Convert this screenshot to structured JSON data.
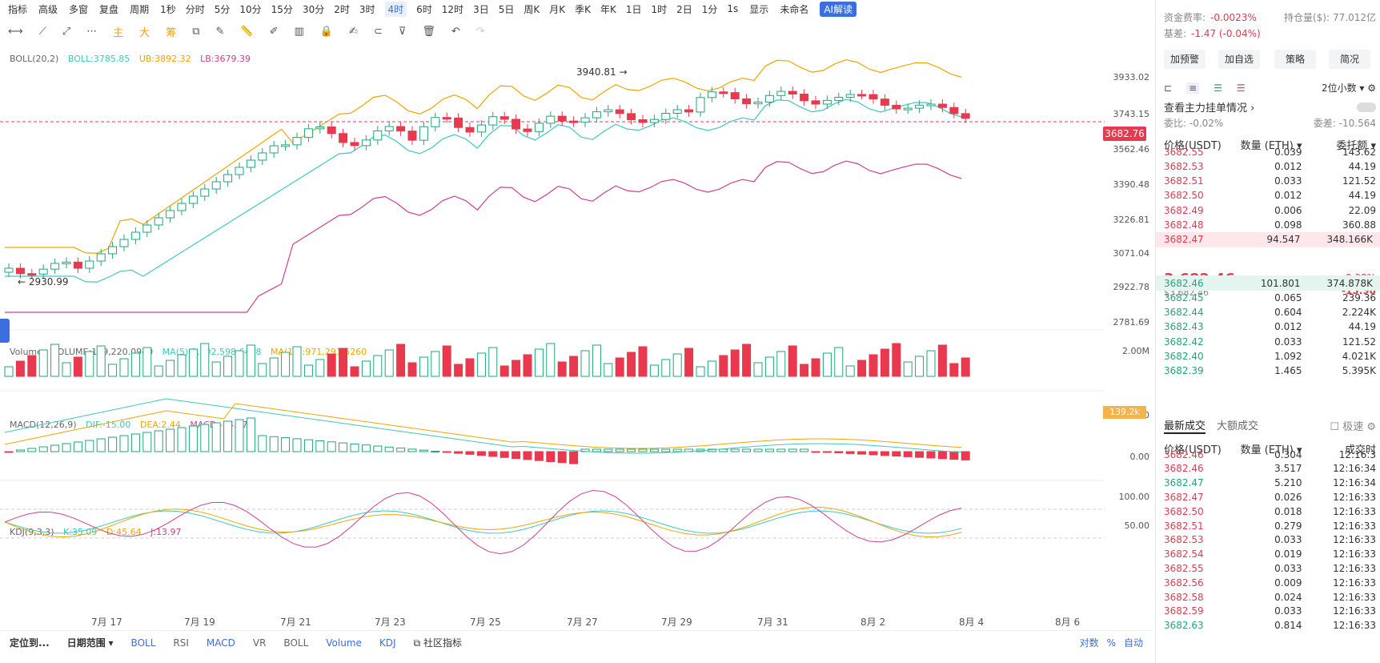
{
  "topbar": {
    "items": [
      "指标",
      "高级",
      "多窗",
      "复盘",
      "周期"
    ],
    "timeframes": [
      "1秒",
      "分时",
      "5分",
      "10分",
      "15分",
      "30分",
      "2时",
      "3时",
      "4时",
      "6时",
      "12时",
      "3日",
      "5日",
      "周K",
      "月K",
      "季K",
      "年K",
      "1日",
      "1时",
      "2日",
      "1分"
    ],
    "active_timeframe": "4时",
    "right_items": [
      "1s",
      "显示",
      "未命名",
      "AI解读"
    ]
  },
  "toolbar": {
    "items": [
      "主",
      "大",
      "筹"
    ]
  },
  "indicators": {
    "boll": {
      "name": "BOLL(20,2)",
      "boll": "BOLL:3785.85",
      "ub": "UB:3892.32",
      "lb": "LB:3679.39"
    },
    "volume": {
      "name": "Volume",
      "volume": "VOLUME:139,220.0940",
      "ma5": "MA(5):1,102,598.6438",
      "ma10": "MA(10):971,291.5260"
    },
    "macd": {
      "name": "MACD(12,26,9)",
      "dif": "DIF:-15.00",
      "dea": "DEA:2.44",
      "macd": "MACD:-34.87"
    },
    "kdj": {
      "name": "KDJ(9,3,3)",
      "k": "K:35.09",
      "d": "D:45.64",
      "j": "J:13.97"
    }
  },
  "price_axis": [
    "3933.02",
    "3743.15",
    "3562.46",
    "3390.48",
    "3226.81",
    "3071.04",
    "2922.78",
    "2781.69"
  ],
  "volume_axis": [
    "2.00M"
  ],
  "macd_axis": [
    "100.00",
    "0.00"
  ],
  "kdj_axis": [
    "100.00",
    "50.00"
  ],
  "current_price_tag": "3682.76",
  "volume_tag": "139.2k",
  "annotations": {
    "high": "3940.81",
    "low": "2930.99"
  },
  "x_axis": [
    "7月 17",
    "7月 19",
    "7月 21",
    "7月 23",
    "7月 25",
    "7月 27",
    "7月 29",
    "7月 31",
    "8月 2",
    "8月 4",
    "8月 6"
  ],
  "bottombar": {
    "locate": "定位到...",
    "date_range": "日期范围",
    "tabs": [
      "BOLL",
      "RSI",
      "MACD",
      "VR",
      "BOLL",
      "Volume",
      "KDJ"
    ],
    "community": "社区指标",
    "right": [
      "对数",
      "%",
      "自动"
    ]
  },
  "right_panel": {
    "header": [
      {
        "label": "资金费率:",
        "value": "-0.0023%"
      },
      {
        "label": "持仓量($):",
        "value": "77.012亿"
      },
      {
        "label": "基差:",
        "value": "-1.47 (-0.04%)"
      }
    ],
    "buttons": [
      "加预警",
      "加自选",
      "策略",
      "简况"
    ],
    "decimals": "2位小数",
    "main_orders": "查看主力挂单情况",
    "wei_bi": "委比: -0.02%",
    "wei_cha": "委差: -10.564",
    "book_headers": [
      "价格(USDT)",
      "数量 (ETH)",
      "委托额"
    ],
    "asks": [
      [
        "3682.55",
        "0.039",
        "143.62"
      ],
      [
        "3682.53",
        "0.012",
        "44.19"
      ],
      [
        "3682.51",
        "0.033",
        "121.52"
      ],
      [
        "3682.50",
        "0.012",
        "44.19"
      ],
      [
        "3682.49",
        "0.006",
        "22.09"
      ],
      [
        "3682.48",
        "0.098",
        "360.88"
      ],
      [
        "3682.47",
        "94.547",
        "348.166K"
      ]
    ],
    "last_price": "3,682.46",
    "last_price_sub": "$3,682.46",
    "change_pct": "-0.38%",
    "change_abs": "-13.98",
    "bids": [
      [
        "3682.46",
        "101.801",
        "374.878K"
      ],
      [
        "3682.45",
        "0.065",
        "239.36"
      ],
      [
        "3682.44",
        "0.604",
        "2.224K"
      ],
      [
        "3682.43",
        "0.012",
        "44.19"
      ],
      [
        "3682.42",
        "0.033",
        "121.52"
      ],
      [
        "3682.40",
        "1.092",
        "4.021K"
      ],
      [
        "3682.39",
        "1.465",
        "5.395K"
      ]
    ],
    "trade_tabs": [
      "最新成交",
      "大额成交"
    ],
    "trade_extra": "极速",
    "trade_headers": [
      "价格(USDT)",
      "数量 (ETH)",
      "成交时"
    ],
    "trades": [
      [
        "3682.46",
        "0.304",
        "12:16:3",
        "red"
      ],
      [
        "3682.46",
        "3.517",
        "12:16:34",
        "red"
      ],
      [
        "3682.47",
        "5.210",
        "12:16:34",
        "green"
      ],
      [
        "3682.47",
        "0.026",
        "12:16:33",
        "red"
      ],
      [
        "3682.50",
        "0.018",
        "12:16:33",
        "red"
      ],
      [
        "3682.51",
        "0.279",
        "12:16:33",
        "red"
      ],
      [
        "3682.53",
        "0.033",
        "12:16:33",
        "red"
      ],
      [
        "3682.54",
        "0.019",
        "12:16:33",
        "red"
      ],
      [
        "3682.55",
        "0.033",
        "12:16:33",
        "red"
      ],
      [
        "3682.56",
        "0.009",
        "12:16:33",
        "red"
      ],
      [
        "3682.58",
        "0.024",
        "12:16:33",
        "red"
      ],
      [
        "3682.59",
        "0.033",
        "12:16:33",
        "red"
      ],
      [
        "3682.63",
        "0.814",
        "12:16:33",
        "green"
      ]
    ]
  },
  "colors": {
    "up": "#21a67a",
    "down": "#e8394f",
    "accent": "#3b6fe0",
    "ub": "#f0a500",
    "lb": "#d0408f",
    "mid": "#3fc8c0"
  }
}
